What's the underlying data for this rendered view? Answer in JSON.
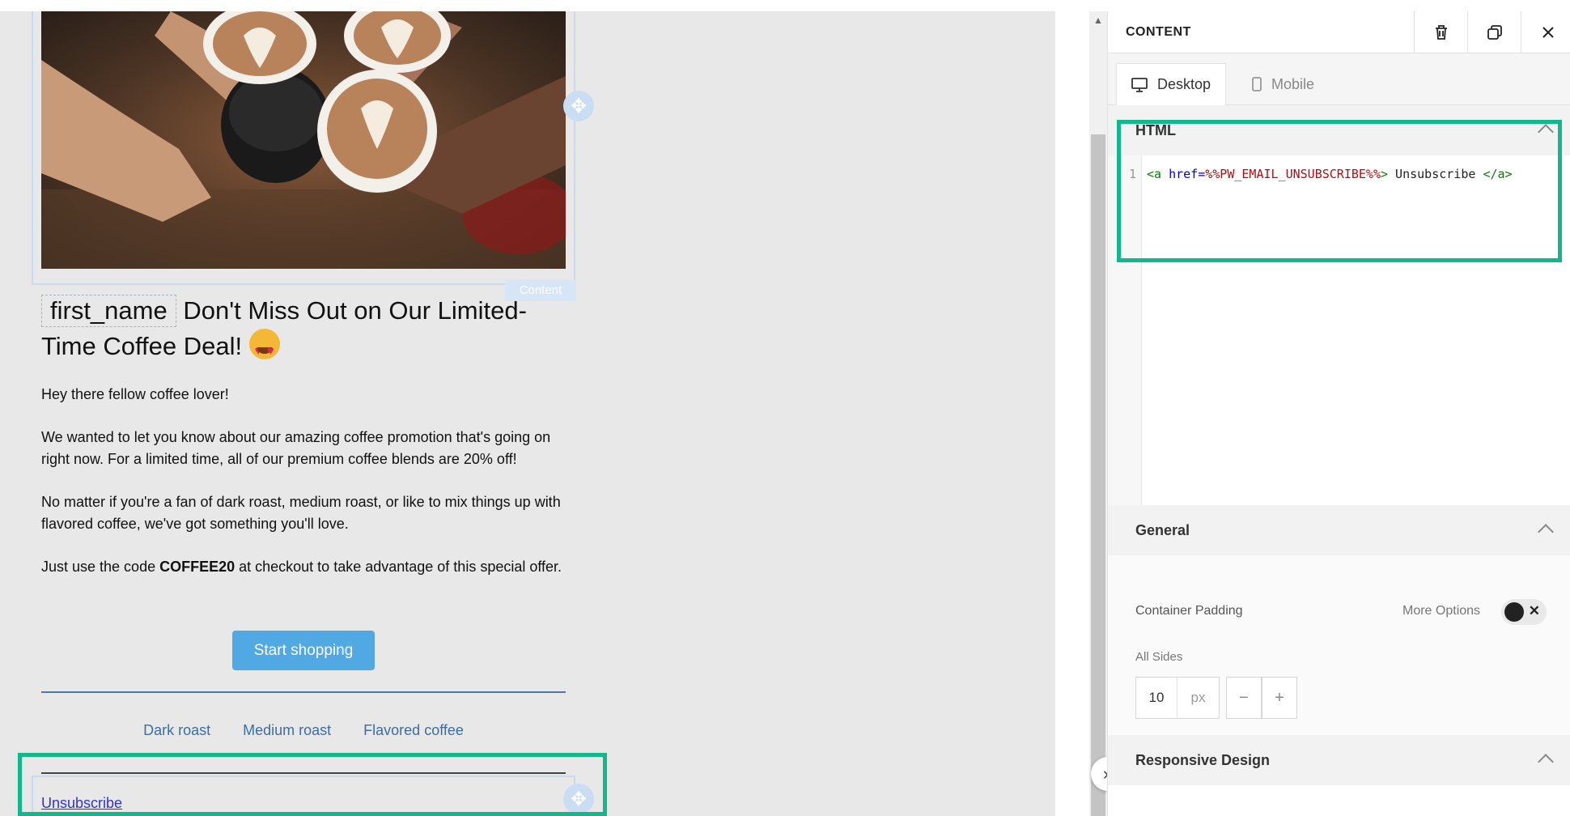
{
  "email": {
    "merge_tag": "first_name",
    "headline": "Don't Miss Out on Our Limited-Time Coffee Deal!",
    "content_tag": "Content",
    "p1": "Hey there fellow coffee lover!",
    "p2": "We wanted to let you know about our amazing coffee promotion that's going on right now. For a limited time, all of our premium coffee blends are 20% off!",
    "p3": "No matter if you're a fan of dark roast, medium roast, or like to mix things up with flavored coffee, we've got something you'll love.",
    "p4_before": "Just use the code ",
    "p4_code": "COFFEE20",
    "p4_after": " at checkout to take advantage of this special offer.",
    "cta_label": "Start shopping",
    "links": [
      "Dark roast",
      "Medium roast",
      "Flavored coffee"
    ],
    "unsubscribe": "Unsubscribe"
  },
  "panel": {
    "title": "CONTENT",
    "tabs": {
      "desktop": "Desktop",
      "mobile": "Mobile"
    },
    "html_section": "HTML",
    "code": {
      "line_number": "1",
      "open_tag": "<a ",
      "attr": "href=",
      "value": "%%PW_EMAIL_UNSUBSCRIBE%%",
      "close_open": ">",
      "text": " Unsubscribe ",
      "close_tag": "</a>"
    },
    "general_section": "General",
    "container_padding": "Container Padding",
    "more_options": "More Options",
    "all_sides": "All Sides",
    "padding_value": "10",
    "padding_unit": "px",
    "minus": "−",
    "plus": "+",
    "responsive_section": "Responsive Design"
  },
  "colors": {
    "highlight": "#10b88a",
    "cta": "#50a9e3",
    "link": "#3a6ea5"
  }
}
